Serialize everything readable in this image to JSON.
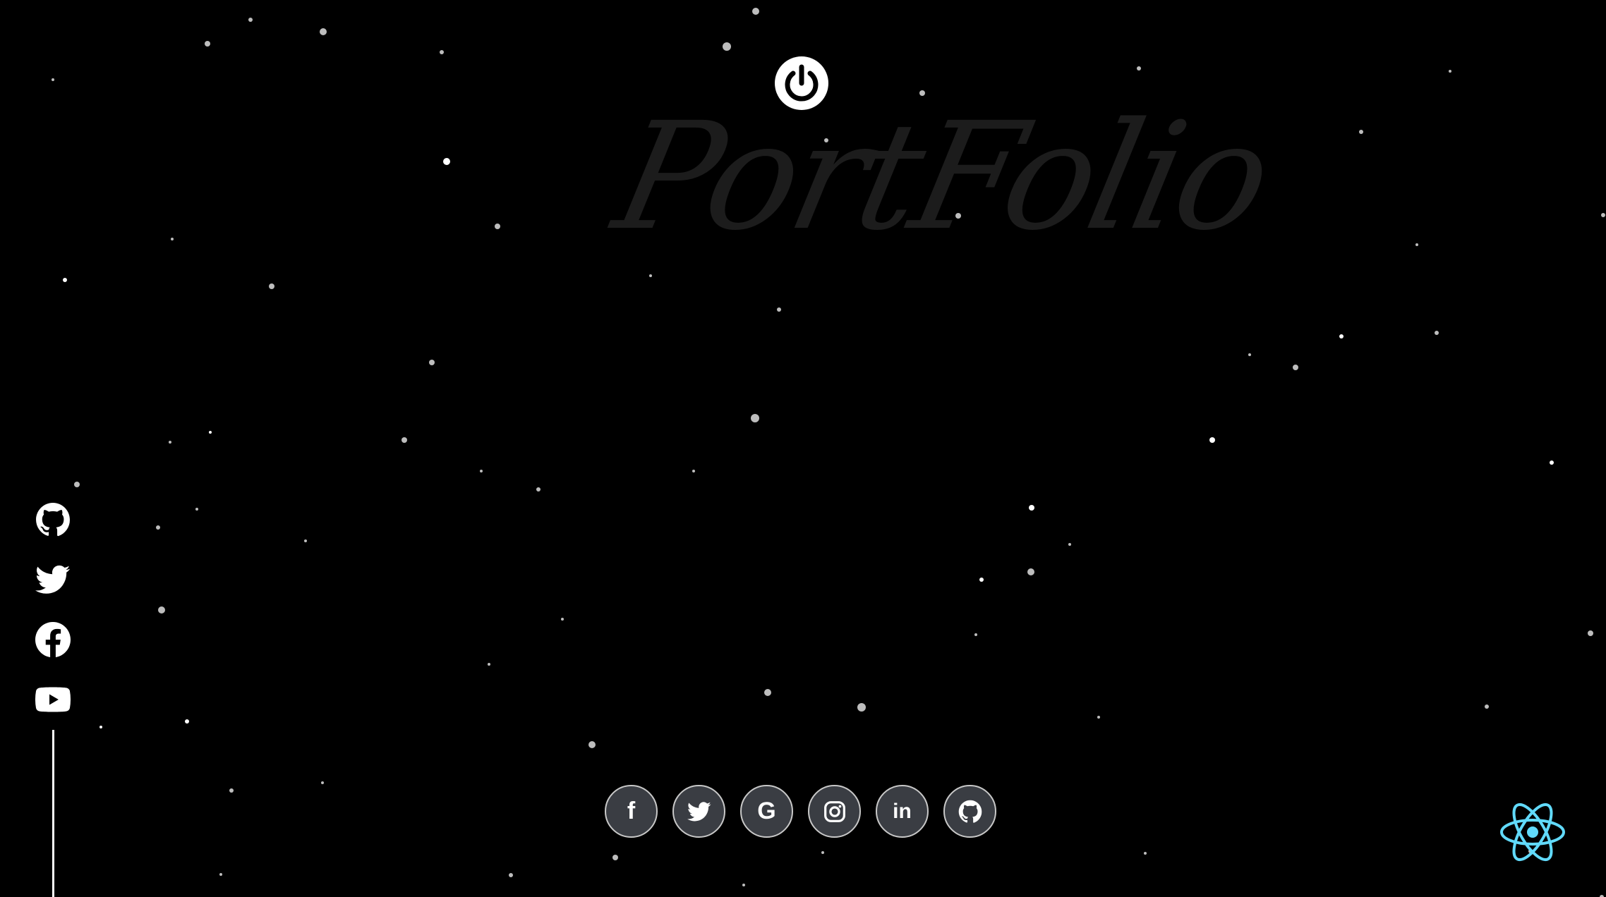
{
  "header": {
    "power_icon": "power-icon",
    "watermark": "PortFolio"
  },
  "side_social": [
    {
      "icon": "github-icon"
    },
    {
      "icon": "twitter-icon"
    },
    {
      "icon": "facebook-icon"
    },
    {
      "icon": "youtube-icon"
    }
  ],
  "bottom_social": [
    {
      "icon": "facebook-icon",
      "glyph": "f"
    },
    {
      "icon": "twitter-icon",
      "glyph": ""
    },
    {
      "icon": "google-icon",
      "glyph": "G"
    },
    {
      "icon": "instagram-icon",
      "glyph": ""
    },
    {
      "icon": "linkedin-icon",
      "glyph": "in"
    },
    {
      "icon": "github-icon",
      "glyph": ""
    }
  ],
  "corner_icon": "react-logo-icon",
  "colors": {
    "background": "#000000",
    "icon": "#ffffff",
    "button_fill": "#3a3d43",
    "watermark": "#1c1c1c",
    "react": "#61dafb"
  }
}
